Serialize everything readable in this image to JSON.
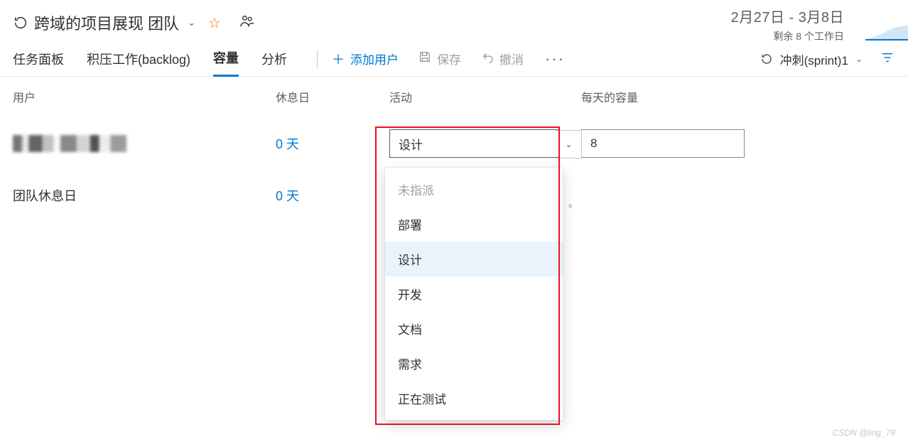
{
  "header": {
    "title": "跨域的项目展现 团队",
    "date_range": "2月27日 - 3月8日",
    "remaining": "剩余 8 个工作日"
  },
  "tabs": {
    "taskboard": "任务面板",
    "backlog": "积压工作(backlog)",
    "capacity": "容量",
    "analytics": "分析"
  },
  "toolbar": {
    "add_user": "添加用户",
    "save": "保存",
    "undo": "撤消",
    "sprint_label": "冲刺(sprint)1"
  },
  "columns": {
    "user": "用户",
    "days_off": "休息日",
    "activity": "活动",
    "capacity": "每天的容量"
  },
  "rows": {
    "user1_days": "0 天",
    "team_days_label": "团队休息日",
    "team_days_value": "0 天"
  },
  "activity": {
    "selected": "设计",
    "options": {
      "unassigned": "未指派",
      "deploy": "部署",
      "design": "设计",
      "dev": "开发",
      "doc": "文档",
      "req": "需求",
      "testing": "正在测试"
    }
  },
  "capacity_value": "8",
  "watermark": "CSDN @ling_78"
}
